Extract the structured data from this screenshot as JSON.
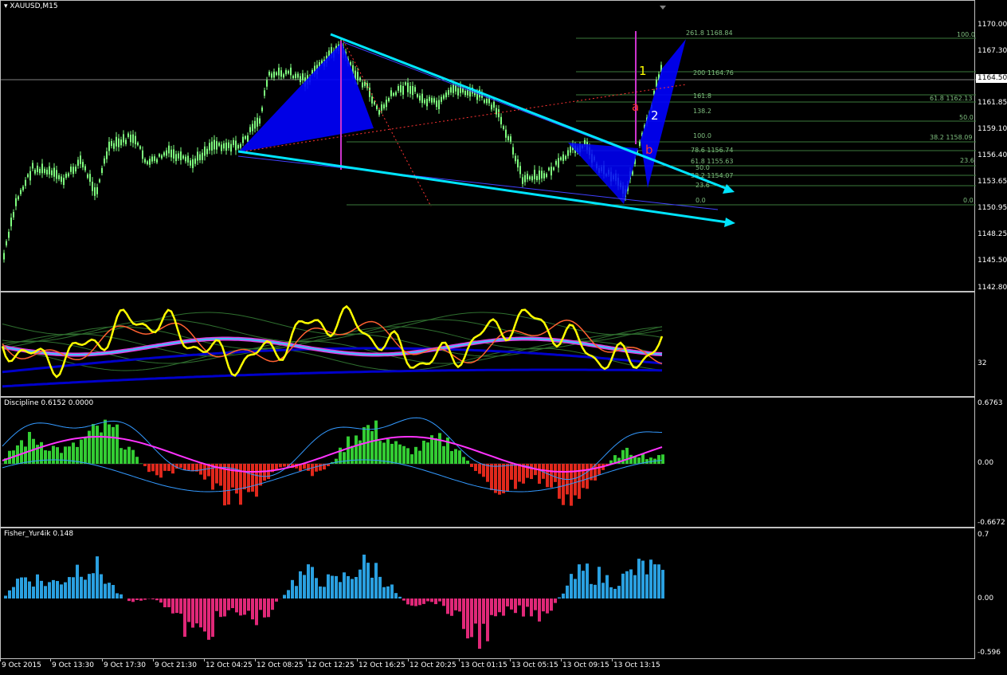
{
  "main": {
    "title": "XAUUSD,M15",
    "current_price": "1164.50",
    "price_axis": [
      "1170.00",
      "1167.30",
      "1161.85",
      "1159.10",
      "1156.40",
      "1153.65",
      "1150.95",
      "1148.25",
      "1145.50",
      "1142.80"
    ],
    "fib_labels": [
      {
        "text": "261.8 1168.84"
      },
      {
        "text": "100.0"
      },
      {
        "text": "200 1164.76"
      },
      {
        "text": "161.8"
      },
      {
        "text": "61.8 1162.13"
      },
      {
        "text": "138.2"
      },
      {
        "text": "50.0"
      },
      {
        "text": "100.0"
      },
      {
        "text": "38.2 1158.09"
      },
      {
        "text": "78.6 1156.74"
      },
      {
        "text": "23.6"
      },
      {
        "text": "61.8 1155.63"
      },
      {
        "text": "50.0"
      },
      {
        "text": "38.2 1154.07"
      },
      {
        "text": "23.6"
      },
      {
        "text": "0.0"
      },
      {
        "text": "0.0"
      }
    ],
    "wave_labels": {
      "w1": "1",
      "w2": "2",
      "wa": "a",
      "wb": "b"
    },
    "colors": {
      "trendline": "#00e5ff",
      "pattern": "#0000ff",
      "vline": "#cc33cc",
      "candle": "#7fff7f",
      "fib": "#3c7a3c",
      "wave_yellow": "#ffff00",
      "wave_red": "#ff3333"
    }
  },
  "osc1": {
    "level_label": "32"
  },
  "discipline": {
    "title": "Discipline 0.6152 0.0000",
    "axis": [
      "0.6763",
      "0.00",
      "-0.6672"
    ]
  },
  "fisher": {
    "title": "Fisher_Yur4ik 0.148",
    "axis": [
      "0.7",
      "0.00",
      "-0.596"
    ]
  },
  "time_axis": [
    "9 Oct 2015",
    "9 Oct 13:30",
    "9 Oct 17:30",
    "9 Oct 21:30",
    "12 Oct 04:25",
    "12 Oct 08:25",
    "12 Oct 12:25",
    "12 Oct 16:25",
    "12 Oct 20:25",
    "13 Oct 01:15",
    "13 Oct 05:15",
    "13 Oct 09:15",
    "13 Oct 13:15"
  ]
}
